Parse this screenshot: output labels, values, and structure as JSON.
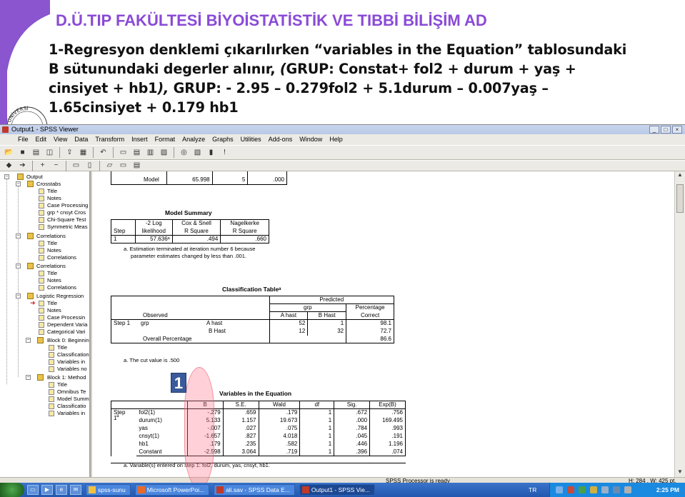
{
  "slide": {
    "title": "D.Ü.TIP FAKÜLTESİ BİYOİSTATİSTİK VE TIBBİ BİLİŞİM AD",
    "line1": "1-Regresyon denklemi çıkarılırken “variables in the Equation” tablosundaki",
    "line2a": "B sütunundaki degerler alınır, ",
    "line2b": "(",
    "line2c": "GRUP: Constat+ fol2 + durum  + yaş +",
    "line3a": "cinsiyet +  hb1",
    "line3b": "),",
    "line3c": " GRUP: - 2.95 – 0.279fol2 + 5.1durum  – 0.007yaş –",
    "line4": "1.65cinsiyet + 0.179 hb1",
    "logo_text": "ÜNİVERSİ"
  },
  "window": {
    "title": "Output1 - SPSS Viewer",
    "buttons": [
      "_",
      "□",
      "×"
    ]
  },
  "menu": [
    "File",
    "Edit",
    "View",
    "Data",
    "Transform",
    "Insert",
    "Format",
    "Analyze",
    "Graphs",
    "Utilities",
    "Add-ons",
    "Window",
    "Help"
  ],
  "outline": {
    "items": [
      "Output",
      "Crosstabs",
      "Title",
      "Notes",
      "Case Processing",
      "grp * cnsyt Cros",
      "Chi-Square Test",
      "Symmetric Meas",
      "Correlations",
      "Title",
      "Notes",
      "Correlations",
      "Correlations",
      "Title",
      "Notes",
      "Correlations",
      "Logistic Regression",
      "Title",
      "Notes",
      "Case Processin",
      "Dependent Varia",
      "Categorical Vari",
      "Block 0: Beginnin",
      "Title",
      "Classification",
      "Variables in",
      "Variables no",
      "Block 1: Method",
      "Title",
      "Omnibus Te",
      "Model Summ",
      "Classificatio",
      "Variables in"
    ]
  },
  "top_table": {
    "rows": [
      [
        "Model",
        "65.998",
        "5",
        ".000"
      ]
    ]
  },
  "model_summary": {
    "title": "Model Summary",
    "headers": [
      "Step",
      "-2 Log likelihood",
      "Cox & Snell R Square",
      "Nagelkerke R Square"
    ],
    "h_step": "Step",
    "h1a": "-2 Log",
    "h1b": "likelihood",
    "h2a": "Cox & Snell",
    "h2b": "R Square",
    "h3a": "Nagelkerke",
    "h3b": "R Square",
    "row": [
      "1",
      "57.636ᵃ",
      ".494",
      ".660"
    ],
    "footnote1": "a. Estimation terminated at iteration number 6 because",
    "footnote2": "parameter estimates changed by less than .001."
  },
  "classification": {
    "title": "Classification Tableᵃ",
    "predicted": "Predicted",
    "grp": "grp",
    "pct1": "Percentage",
    "pct2": "Correct",
    "observed": "Observed",
    "ahast": "A hast",
    "bhast": "B Hast",
    "step": "Step 1",
    "grp_row": "grp",
    "row1": [
      "A hast",
      "52",
      "1",
      "98.1"
    ],
    "row2": [
      "B Hast",
      "12",
      "32",
      "72.7"
    ],
    "overall": [
      "Overall Percentage",
      "86.6"
    ],
    "footnote": "a. The cut value is .500"
  },
  "variables_eq": {
    "title": "Variables in the Equation",
    "badge": "1",
    "headers": [
      "",
      "",
      "B",
      "S.E.",
      "Wald",
      "df",
      "Sig.",
      "Exp(B)"
    ],
    "step_label": "Step",
    "step_sup": "a",
    "step_num": "1",
    "rows": [
      [
        "fol2(1)",
        "-.279",
        ".659",
        ".179",
        "1",
        ".672",
        ".756"
      ],
      [
        "durum(1)",
        "5.133",
        "1.157",
        "19.673",
        "1",
        ".000",
        "169.495"
      ],
      [
        "yas",
        "-.007",
        ".027",
        ".075",
        "1",
        ".784",
        ".993"
      ],
      [
        "cnsyt(1)",
        "-1.657",
        ".827",
        "4.018",
        "1",
        ".045",
        ".191"
      ],
      [
        "hb1",
        ".179",
        ".235",
        ".582",
        "1",
        ".446",
        "1.196"
      ],
      [
        "Constant",
        "-2.598",
        "3.064",
        ".719",
        "1",
        ".396",
        ".074"
      ]
    ],
    "footnote": "a. Variable(s) entered on step 1: fol2, durum, yas, cnsyt, hb1."
  },
  "status": {
    "processor": "SPSS Processor  is ready",
    "dims": "H: 284 , W: 425  pt."
  },
  "taskbar": {
    "tasks": [
      "spss-sunu",
      "Microsoft PowerPoi...",
      "ali.sav - SPSS Data E...",
      "Output1 - SPSS Vie..."
    ],
    "lang": "TR",
    "clock": "2:25 PM"
  },
  "colors": {
    "title": "#8a4ad6",
    "highlight_oval": "#ff7890",
    "badge": "#3a5a9a"
  }
}
